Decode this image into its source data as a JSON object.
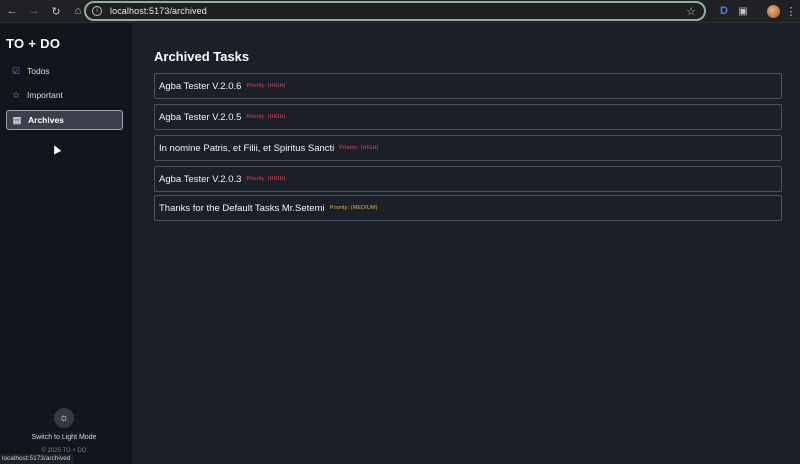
{
  "browser": {
    "url": "localhost:5173/archived",
    "status_url": "localhost:5173/archived"
  },
  "sidebar": {
    "brand": "TO + DO",
    "items": [
      {
        "label": "Todos",
        "icon": "checkbox-icon"
      },
      {
        "label": "Important",
        "icon": "star-icon"
      },
      {
        "label": "Archives",
        "icon": "archive-icon",
        "active": true
      }
    ],
    "theme_toggle_label": "Switch to Light Mode",
    "copyright": "© 2025 TO + DO"
  },
  "main": {
    "title": "Archived Tasks",
    "tasks": [
      {
        "title": "Agba Tester V.2.0.6",
        "priority": "Priority: (HIGH)",
        "priority_level": "high"
      },
      {
        "title": "Agba Tester V.2.0.5",
        "priority": "Priority: (HIGH)",
        "priority_level": "high"
      },
      {
        "title": "In nomine Patris, et Filii, et Spiritus Sancti",
        "priority": "Priority: (HIGH)",
        "priority_level": "high"
      },
      {
        "title": "Agba Tester V.2.0.3",
        "priority": "Priority: (HIGH)",
        "priority_level": "high"
      },
      {
        "title": "Thanks for the Default Tasks Mr.Setemi",
        "priority": "Priority: (MEDIUM)",
        "priority_level": "medium"
      }
    ]
  },
  "colors": {
    "accent": "#4c8dff",
    "priority_high": "#e0474d",
    "priority_medium": "#e3b341",
    "sidebar_bg": "#12151c",
    "main_bg": "#1b1f28"
  }
}
